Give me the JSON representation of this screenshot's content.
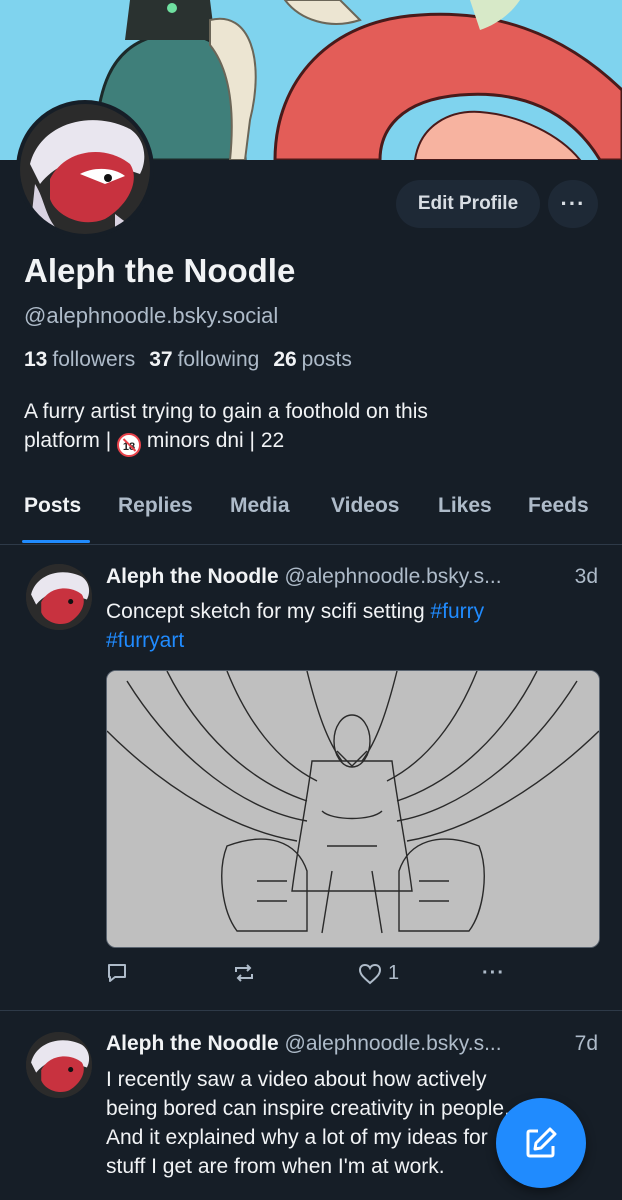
{
  "profile": {
    "display_name": "Aleph the Noodle",
    "handle": "@alephnoodle.bsky.social",
    "followers_count": "13",
    "followers_label": "followers",
    "following_count": "37",
    "following_label": "following",
    "posts_count": "26",
    "posts_label": "posts",
    "bio_line1": "A furry artist trying to gain a foothold on this",
    "bio_line2_a": "platform |",
    "bio_line2_b": "minors dni | 22",
    "bio_badge": "18"
  },
  "header_buttons": {
    "edit_profile": "Edit Profile",
    "more": "···"
  },
  "tabs": [
    {
      "label": "Posts",
      "active": true
    },
    {
      "label": "Replies"
    },
    {
      "label": "Media"
    },
    {
      "label": "Videos"
    },
    {
      "label": "Likes"
    },
    {
      "label": "Feeds"
    }
  ],
  "posts": [
    {
      "author": "Aleph the Noodle",
      "handle": "@alephnoodle.bsky.s...",
      "time": "3d",
      "text": "Concept sketch for my scifi setting",
      "tags": [
        "#furry",
        "#furryart"
      ],
      "like_count": "1"
    },
    {
      "author": "Aleph the Noodle",
      "handle": "@alephnoodle.bsky.s...",
      "time": "7d",
      "lines": [
        "I recently saw a video about how actively",
        "being bored can inspire creativity in people.",
        "And it explained why a lot of my ideas for",
        "stuff I get are from when I'm at work."
      ]
    }
  ],
  "colors": {
    "background": "#161e27",
    "accent": "#208bfe",
    "muted": "#aebbc9",
    "pill": "#1e2936"
  },
  "icons": [
    "comment-icon",
    "repost-icon",
    "heart-icon",
    "more-icon",
    "compose-icon"
  ]
}
